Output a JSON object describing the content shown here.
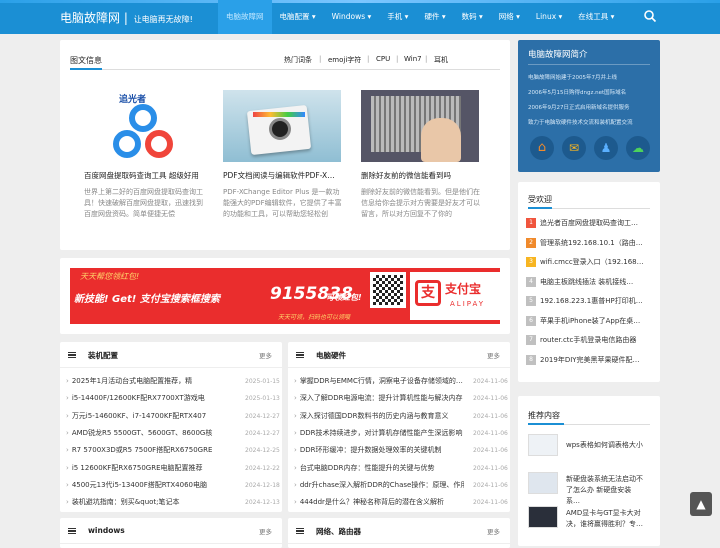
{
  "header": {
    "logo": "电脑故障网",
    "tagline": "让电脑再无故障!",
    "nav": [
      "电脑故障网",
      "电脑配置 ▾",
      "Windows ▾",
      "手机 ▾",
      "硬件 ▾",
      "数码 ▾",
      "网络 ▾",
      "Linux ▾",
      "在线工具 ▾"
    ]
  },
  "news": {
    "title": "图文信息",
    "tabs": [
      "热门词条",
      "emoji字符",
      "CPU",
      "Win7",
      "耳机"
    ],
    "cards": [
      {
        "title": "百度网盘提取码查询工具 超级好用",
        "desc": "世界上第二好的百度网盘提取码查询工具！快速破解百度网盘提取，迅速找到百度网盘资码。简单便捷无偿"
      },
      {
        "title": "PDF文档阅读与编辑软件PDF-X…",
        "desc": "PDF-XChange Editor Plus 是一款功能强大的PDF编辑软件，它提供了丰富的功能和工具，可以帮助您轻松创"
      },
      {
        "title": "删除好友前的微信能看到吗",
        "desc": "删除好友前的微信能看到。但是他们在信息给你会提示对方需要是好友才可以留言，所以对方回复不了你的"
      }
    ],
    "card1_logo": "追光者"
  },
  "ad": {
    "line1": "天天帮您领红包!",
    "line2": "新技能! Get! 支付宝搜索框搜索",
    "code": "9155838",
    "line3": "可领红包!",
    "line4": "天天可领，扫码也可以领哦",
    "brand": "支付宝",
    "brand_en": "ALIPAY"
  },
  "config": {
    "title": "装机配置",
    "more": "更多",
    "items": [
      {
        "t": "2025年1月活动台式电脑配置推荐，精",
        "d": "2025-01-15"
      },
      {
        "t": "i5-14400F/12600KF配RX7700XT游戏电",
        "d": "2025-01-13"
      },
      {
        "t": "万元i5-14600KF、i7-14700KF配RTX407",
        "d": "2024-12-27"
      },
      {
        "t": "AMD锐龙R5 5500GT、5600GT、8600G核",
        "d": "2024-12-27"
      },
      {
        "t": "R7 5700X3D或R5 7500F搭配RX6750GRE",
        "d": "2024-12-25"
      },
      {
        "t": "i5 12600KF配RX6750GRE电脑配置推荐",
        "d": "2024-12-22"
      },
      {
        "t": "4500元13代i5-13400F搭配RTX4060电脑",
        "d": "2024-12-18"
      },
      {
        "t": "装机避坑指南：别买&quot;笔记本",
        "d": "2024-12-13"
      }
    ]
  },
  "hardware": {
    "title": "电脑硬件",
    "more": "更多",
    "items": [
      {
        "t": "掌握DDR与EMMC行情，洞察电子设备存储领域的…",
        "d": "2024-11-06"
      },
      {
        "t": "深入了解DDR电源电流：提升计算机性能与解决内存",
        "d": "2024-11-06"
      },
      {
        "t": "深入探讨德国DDR数料书的历史内涵与教育意义",
        "d": "2024-11-06"
      },
      {
        "t": "DDR技术持续进步，对计算机存储性能产生深远影响",
        "d": "2024-11-06"
      },
      {
        "t": "DDR环形缓冲：提升数据处理效率的关键机制",
        "d": "2024-11-06"
      },
      {
        "t": "台式电脑DDR内存：性能提升的关键与优势",
        "d": "2024-11-06"
      },
      {
        "t": "ddr升chase深入解析DDR的Chase操作：原理、作用",
        "d": "2024-11-06"
      },
      {
        "t": "444ddr是什么？神秘名称背后的潜在含义解析",
        "d": "2024-11-06"
      }
    ]
  },
  "bottom": {
    "left": "windows",
    "right": "网络、路由器",
    "more": "更多"
  },
  "sidebar": {
    "intro_title": "电脑故障网简介",
    "intro": [
      "电脑故障网始建于2005年7月并上线",
      "2006年5月15日购得dngz.net国际域名",
      "2006年9月27日正式启用新域名提供服务",
      "致力于电脑软硬件技术交流和装机配置交流"
    ],
    "hot_title": "受欢迎",
    "hot": [
      "追光者百度网盘提取码查询工…",
      "管理系统192.168.10.1（路由…",
      "wifi.cmcc登录入口（192.168…",
      "电脑主板跳线插法 装机接线…",
      "192.168.223.1惠普HP打印机…",
      "苹果手机iPhone装了App在桌…",
      "router.ctc手机登录电信路由器",
      "2019年DIY完美黑苹果硬件配…"
    ],
    "rec_title": "推荐内容",
    "rec": [
      "wps表格如何调表格大小",
      "新硬盘装系统无法启动不了怎么办 新硬盘安装系…",
      "AMD显卡与GT显卡大对决，谁将赢得胜利？专…"
    ]
  },
  "colors": {
    "accent": "#1b8fd4",
    "rank1": "#f0553d",
    "rank2": "#f08a2c",
    "rank3": "#f7b521",
    "rankN": "#c0c0c0"
  }
}
